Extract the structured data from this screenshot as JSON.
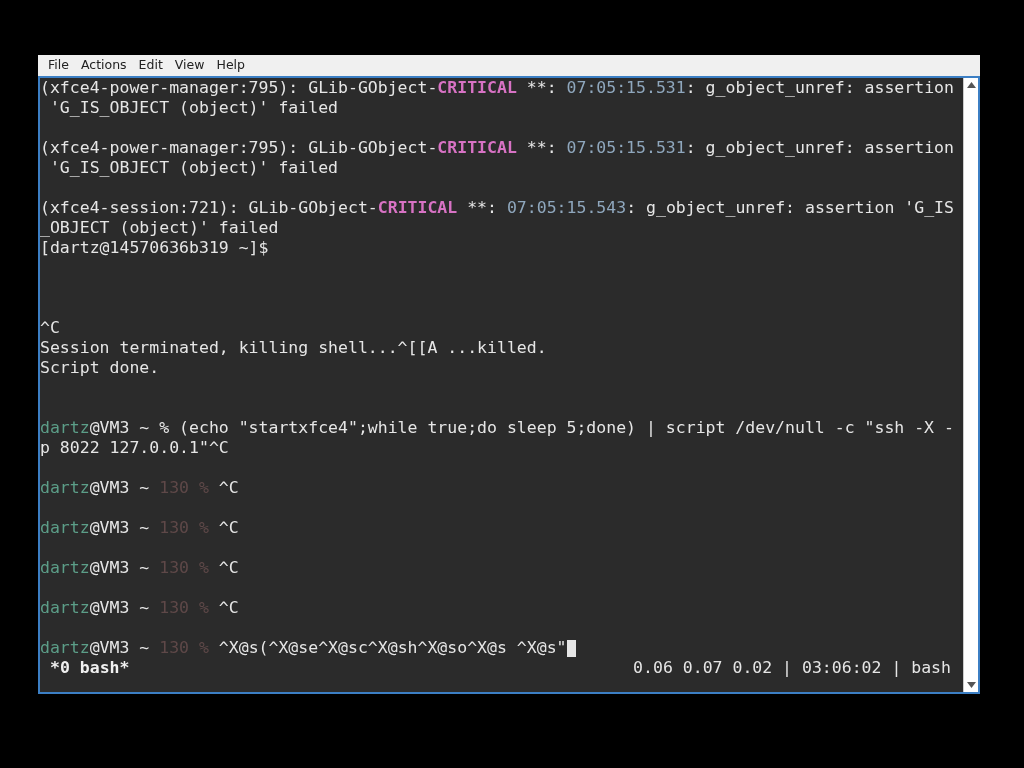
{
  "menu": [
    "File",
    "Actions",
    "Edit",
    "View",
    "Help"
  ],
  "lines": [
    {
      "kind": "text",
      "segments": [
        {
          "kind": "plain",
          "text": "(xfce4-power-manager:795): GLib-GObject-"
        },
        {
          "kind": "critical",
          "text": "CRITICAL"
        },
        {
          "kind": "plain",
          "text": " **: "
        },
        {
          "kind": "timestamp",
          "text": "07:05:15.531"
        },
        {
          "kind": "plain",
          "text": ": g_object_unref: assertion"
        }
      ]
    },
    {
      "kind": "text",
      "segments": [
        {
          "kind": "plain",
          "text": " 'G_IS_OBJECT (object)' failed"
        }
      ]
    },
    {
      "kind": "blank"
    },
    {
      "kind": "text",
      "segments": [
        {
          "kind": "plain",
          "text": "(xfce4-power-manager:795): GLib-GObject-"
        },
        {
          "kind": "critical",
          "text": "CRITICAL"
        },
        {
          "kind": "plain",
          "text": " **: "
        },
        {
          "kind": "timestamp",
          "text": "07:05:15.531"
        },
        {
          "kind": "plain",
          "text": ": g_object_unref: assertion"
        }
      ]
    },
    {
      "kind": "text",
      "segments": [
        {
          "kind": "plain",
          "text": " 'G_IS_OBJECT (object)' failed"
        }
      ]
    },
    {
      "kind": "blank"
    },
    {
      "kind": "text",
      "segments": [
        {
          "kind": "plain",
          "text": "(xfce4-session:721): GLib-GObject-"
        },
        {
          "kind": "critical",
          "text": "CRITICAL"
        },
        {
          "kind": "plain",
          "text": " **: "
        },
        {
          "kind": "timestamp",
          "text": "07:05:15.543"
        },
        {
          "kind": "plain",
          "text": ": g_object_unref: assertion 'G_IS"
        }
      ]
    },
    {
      "kind": "text",
      "segments": [
        {
          "kind": "plain",
          "text": "_OBJECT (object)' failed"
        }
      ]
    },
    {
      "kind": "text",
      "segments": [
        {
          "kind": "plain",
          "text": "[dartz@14570636b319 ~]$"
        }
      ]
    },
    {
      "kind": "blank"
    },
    {
      "kind": "blank"
    },
    {
      "kind": "blank"
    },
    {
      "kind": "text",
      "segments": [
        {
          "kind": "plain",
          "text": "^C"
        }
      ]
    },
    {
      "kind": "text",
      "segments": [
        {
          "kind": "plain",
          "text": "Session terminated, killing shell...^[[A ...killed."
        }
      ]
    },
    {
      "kind": "text",
      "segments": [
        {
          "kind": "plain",
          "text": "Script done."
        }
      ]
    },
    {
      "kind": "blank"
    },
    {
      "kind": "blank"
    },
    {
      "kind": "text",
      "segments": [
        {
          "kind": "user",
          "text": "dartz"
        },
        {
          "kind": "plain",
          "text": "@VM3 ~ % (echo \"startxfce4\";while true;do sleep 5;done) | script /dev/null -c \"ssh -X -"
        }
      ]
    },
    {
      "kind": "text",
      "segments": [
        {
          "kind": "plain",
          "text": "p 8022 127.0.0.1\"^C"
        }
      ]
    },
    {
      "kind": "blank"
    },
    {
      "kind": "text",
      "segments": [
        {
          "kind": "user",
          "text": "dartz"
        },
        {
          "kind": "plain",
          "text": "@VM3 ~ "
        },
        {
          "kind": "dim",
          "text": "130 %"
        },
        {
          "kind": "plain",
          "text": " ^C"
        }
      ]
    },
    {
      "kind": "blank"
    },
    {
      "kind": "text",
      "segments": [
        {
          "kind": "user",
          "text": "dartz"
        },
        {
          "kind": "plain",
          "text": "@VM3 ~ "
        },
        {
          "kind": "dim",
          "text": "130 %"
        },
        {
          "kind": "plain",
          "text": " ^C"
        }
      ]
    },
    {
      "kind": "blank"
    },
    {
      "kind": "text",
      "segments": [
        {
          "kind": "user",
          "text": "dartz"
        },
        {
          "kind": "plain",
          "text": "@VM3 ~ "
        },
        {
          "kind": "dim",
          "text": "130 %"
        },
        {
          "kind": "plain",
          "text": " ^C"
        }
      ]
    },
    {
      "kind": "blank"
    },
    {
      "kind": "text",
      "segments": [
        {
          "kind": "user",
          "text": "dartz"
        },
        {
          "kind": "plain",
          "text": "@VM3 ~ "
        },
        {
          "kind": "dim",
          "text": "130 %"
        },
        {
          "kind": "plain",
          "text": " ^C"
        }
      ]
    },
    {
      "kind": "blank"
    },
    {
      "kind": "text",
      "cursor": true,
      "segments": [
        {
          "kind": "user",
          "text": "dartz"
        },
        {
          "kind": "plain",
          "text": "@VM3 ~ "
        },
        {
          "kind": "dim",
          "text": "130 %"
        },
        {
          "kind": "plain",
          "text": " ^X@s(^X@se^X@sc^X@sh^X@so^X@s ^X@s\""
        }
      ]
    }
  ],
  "status_bar": {
    "window": "*0 bash*",
    "info": "0.06 0.07 0.02 | 03:06:02 | bash"
  }
}
